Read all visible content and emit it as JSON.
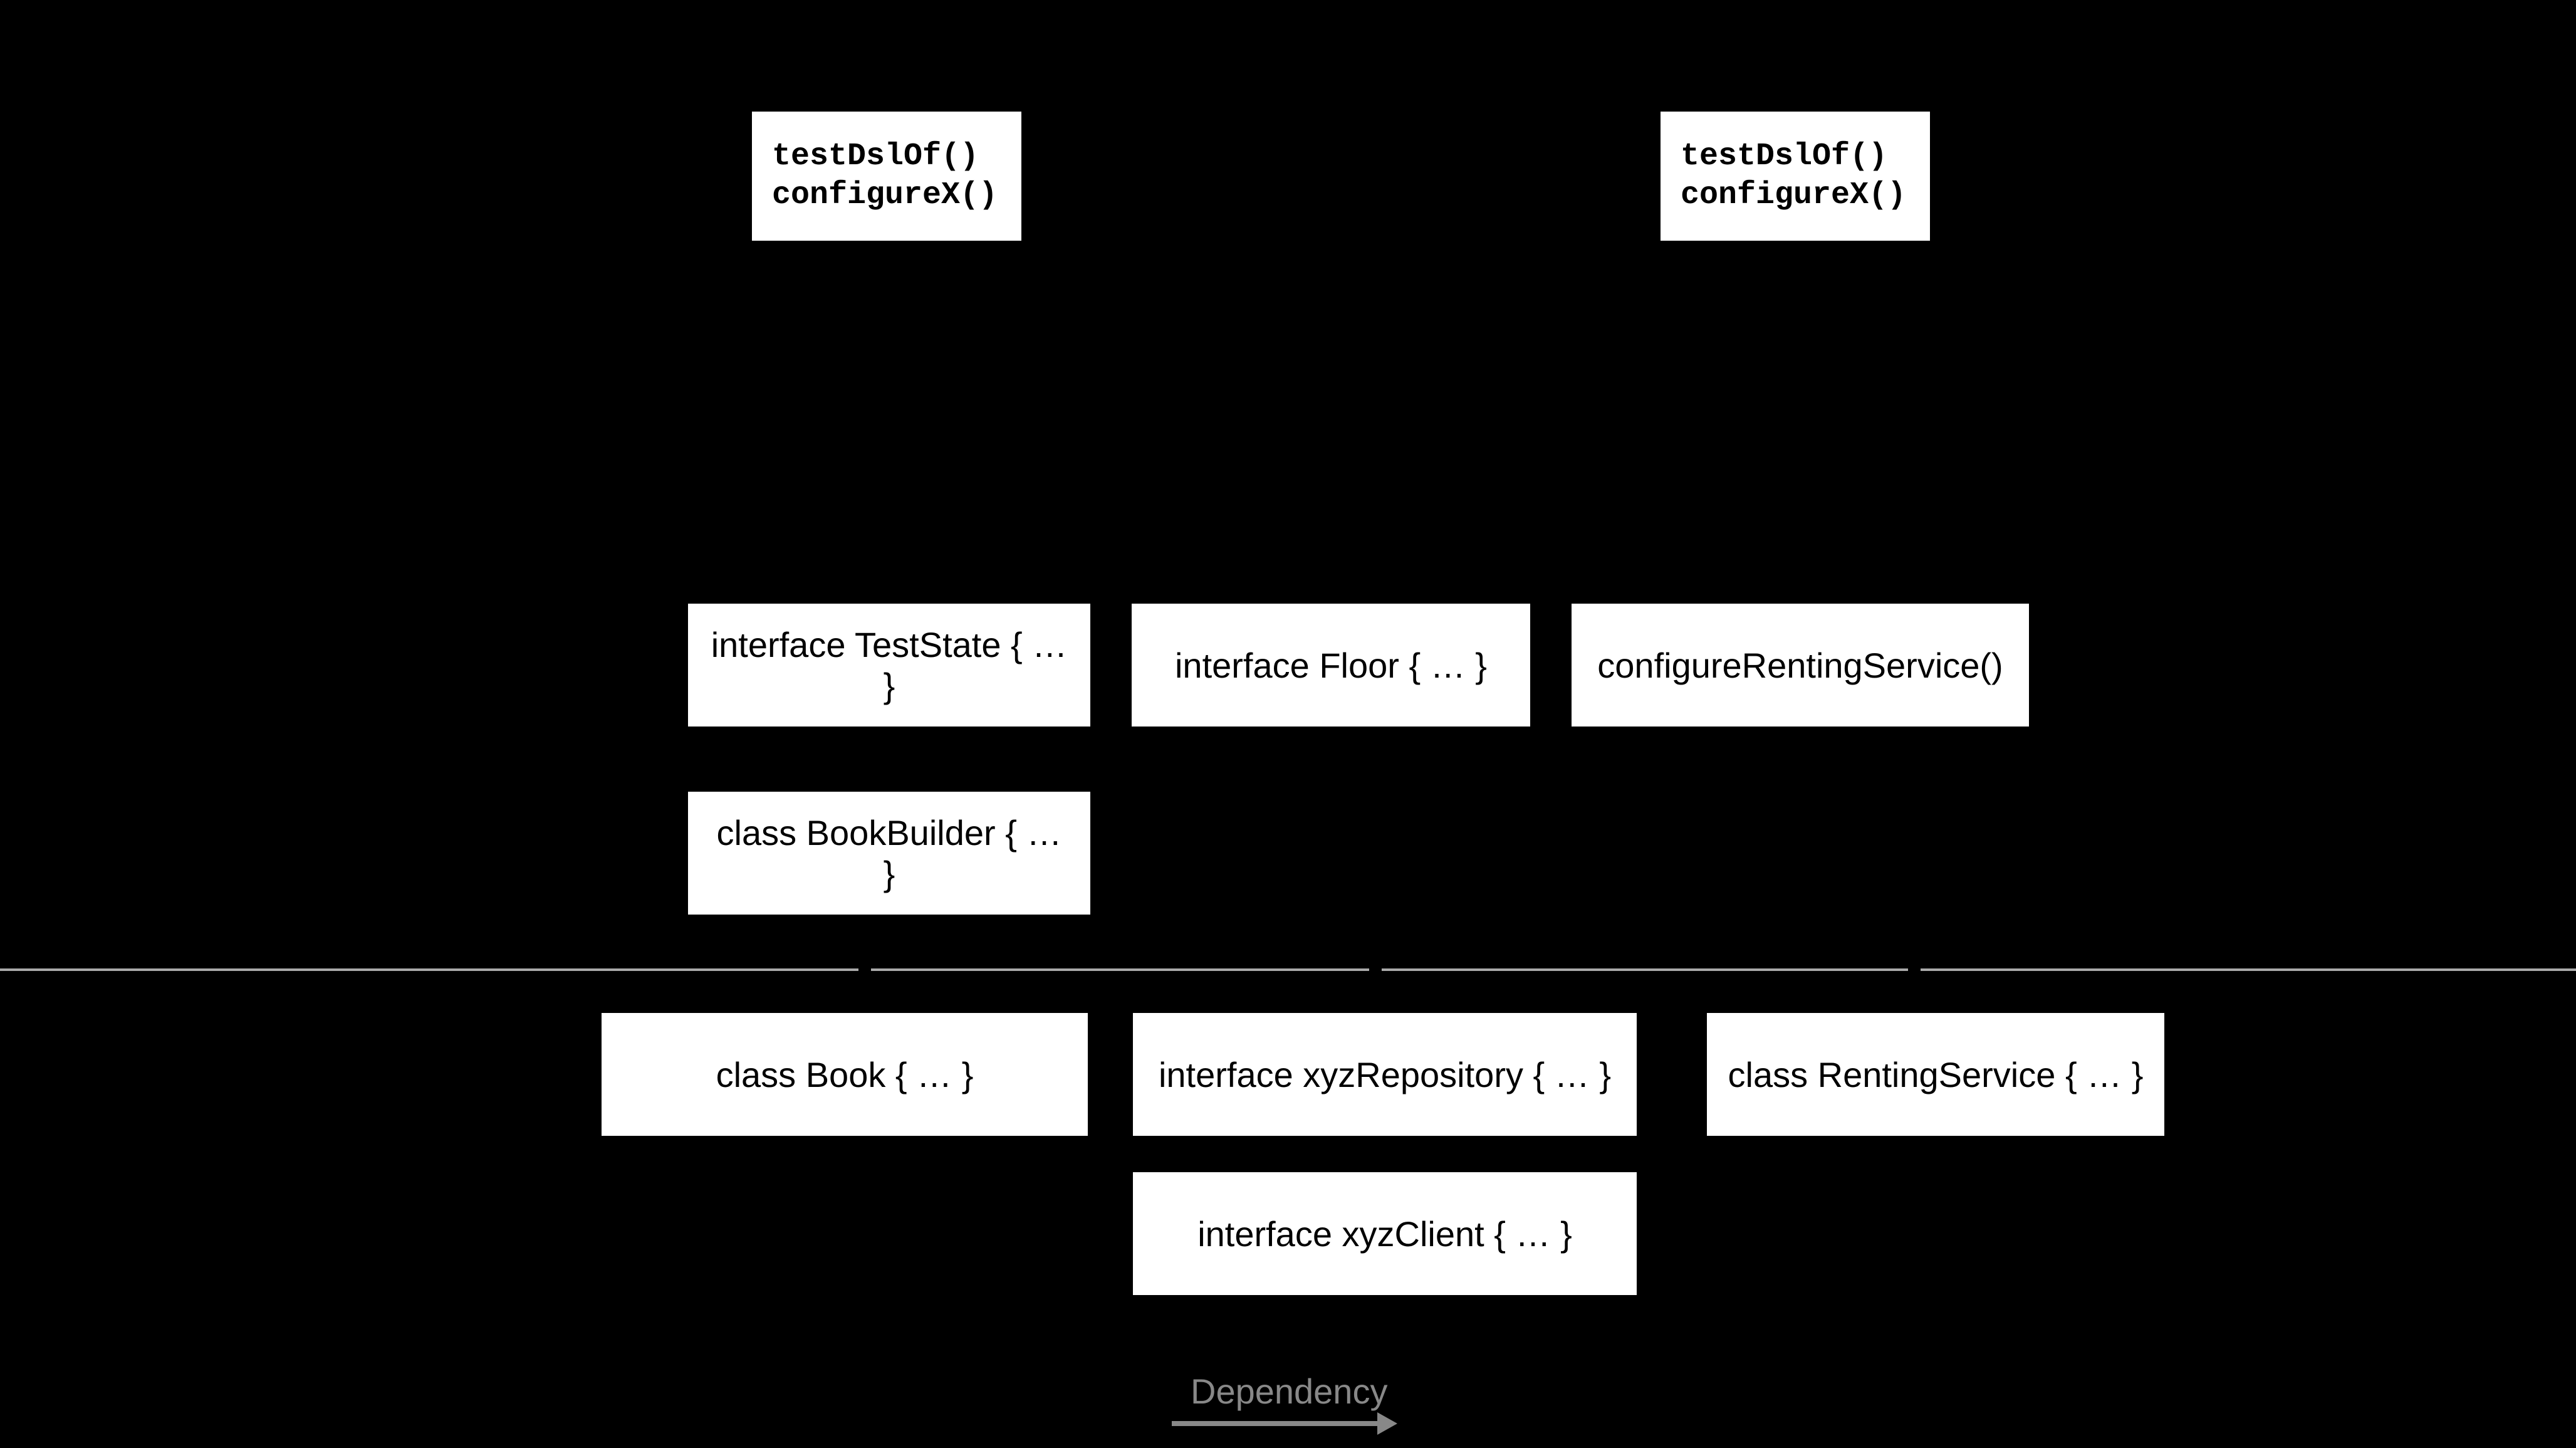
{
  "topLeft": {
    "line1": "testDslOf()",
    "line2": "configureX()"
  },
  "topRight": {
    "line1": "testDslOf()",
    "line2": "configureX()"
  },
  "midRow": {
    "testState": "interface TestState { … }",
    "floor": "interface Floor { … }",
    "configureRenting": "configureRentingService()",
    "bookBuilder": "class BookBuilder { … }"
  },
  "bottomRow": {
    "book": "class Book { … }",
    "xyzRepository": "interface xyzRepository { … }",
    "xyzClient": "interface xyzClient { … }",
    "rentingService": "class RentingService { … }"
  },
  "legend": {
    "dependency": "Dependency"
  }
}
